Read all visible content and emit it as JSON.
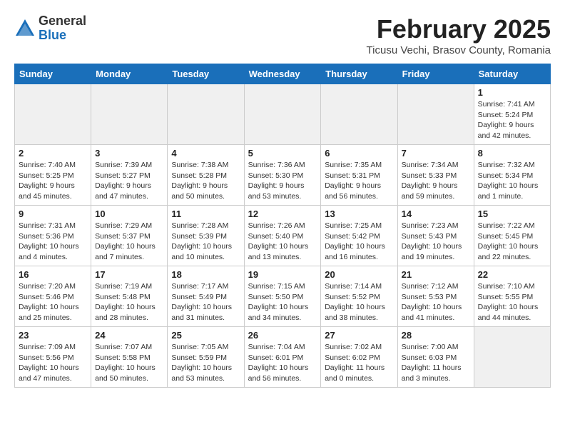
{
  "logo": {
    "general": "General",
    "blue": "Blue"
  },
  "header": {
    "month": "February 2025",
    "location": "Ticusu Vechi, Brasov County, Romania"
  },
  "weekdays": [
    "Sunday",
    "Monday",
    "Tuesday",
    "Wednesday",
    "Thursday",
    "Friday",
    "Saturday"
  ],
  "weeks": [
    [
      {
        "day": "",
        "info": ""
      },
      {
        "day": "",
        "info": ""
      },
      {
        "day": "",
        "info": ""
      },
      {
        "day": "",
        "info": ""
      },
      {
        "day": "",
        "info": ""
      },
      {
        "day": "",
        "info": ""
      },
      {
        "day": "1",
        "info": "Sunrise: 7:41 AM\nSunset: 5:24 PM\nDaylight: 9 hours and 42 minutes."
      }
    ],
    [
      {
        "day": "2",
        "info": "Sunrise: 7:40 AM\nSunset: 5:25 PM\nDaylight: 9 hours and 45 minutes."
      },
      {
        "day": "3",
        "info": "Sunrise: 7:39 AM\nSunset: 5:27 PM\nDaylight: 9 hours and 47 minutes."
      },
      {
        "day": "4",
        "info": "Sunrise: 7:38 AM\nSunset: 5:28 PM\nDaylight: 9 hours and 50 minutes."
      },
      {
        "day": "5",
        "info": "Sunrise: 7:36 AM\nSunset: 5:30 PM\nDaylight: 9 hours and 53 minutes."
      },
      {
        "day": "6",
        "info": "Sunrise: 7:35 AM\nSunset: 5:31 PM\nDaylight: 9 hours and 56 minutes."
      },
      {
        "day": "7",
        "info": "Sunrise: 7:34 AM\nSunset: 5:33 PM\nDaylight: 9 hours and 59 minutes."
      },
      {
        "day": "8",
        "info": "Sunrise: 7:32 AM\nSunset: 5:34 PM\nDaylight: 10 hours and 1 minute."
      }
    ],
    [
      {
        "day": "9",
        "info": "Sunrise: 7:31 AM\nSunset: 5:36 PM\nDaylight: 10 hours and 4 minutes."
      },
      {
        "day": "10",
        "info": "Sunrise: 7:29 AM\nSunset: 5:37 PM\nDaylight: 10 hours and 7 minutes."
      },
      {
        "day": "11",
        "info": "Sunrise: 7:28 AM\nSunset: 5:39 PM\nDaylight: 10 hours and 10 minutes."
      },
      {
        "day": "12",
        "info": "Sunrise: 7:26 AM\nSunset: 5:40 PM\nDaylight: 10 hours and 13 minutes."
      },
      {
        "day": "13",
        "info": "Sunrise: 7:25 AM\nSunset: 5:42 PM\nDaylight: 10 hours and 16 minutes."
      },
      {
        "day": "14",
        "info": "Sunrise: 7:23 AM\nSunset: 5:43 PM\nDaylight: 10 hours and 19 minutes."
      },
      {
        "day": "15",
        "info": "Sunrise: 7:22 AM\nSunset: 5:45 PM\nDaylight: 10 hours and 22 minutes."
      }
    ],
    [
      {
        "day": "16",
        "info": "Sunrise: 7:20 AM\nSunset: 5:46 PM\nDaylight: 10 hours and 25 minutes."
      },
      {
        "day": "17",
        "info": "Sunrise: 7:19 AM\nSunset: 5:48 PM\nDaylight: 10 hours and 28 minutes."
      },
      {
        "day": "18",
        "info": "Sunrise: 7:17 AM\nSunset: 5:49 PM\nDaylight: 10 hours and 31 minutes."
      },
      {
        "day": "19",
        "info": "Sunrise: 7:15 AM\nSunset: 5:50 PM\nDaylight: 10 hours and 34 minutes."
      },
      {
        "day": "20",
        "info": "Sunrise: 7:14 AM\nSunset: 5:52 PM\nDaylight: 10 hours and 38 minutes."
      },
      {
        "day": "21",
        "info": "Sunrise: 7:12 AM\nSunset: 5:53 PM\nDaylight: 10 hours and 41 minutes."
      },
      {
        "day": "22",
        "info": "Sunrise: 7:10 AM\nSunset: 5:55 PM\nDaylight: 10 hours and 44 minutes."
      }
    ],
    [
      {
        "day": "23",
        "info": "Sunrise: 7:09 AM\nSunset: 5:56 PM\nDaylight: 10 hours and 47 minutes."
      },
      {
        "day": "24",
        "info": "Sunrise: 7:07 AM\nSunset: 5:58 PM\nDaylight: 10 hours and 50 minutes."
      },
      {
        "day": "25",
        "info": "Sunrise: 7:05 AM\nSunset: 5:59 PM\nDaylight: 10 hours and 53 minutes."
      },
      {
        "day": "26",
        "info": "Sunrise: 7:04 AM\nSunset: 6:01 PM\nDaylight: 10 hours and 56 minutes."
      },
      {
        "day": "27",
        "info": "Sunrise: 7:02 AM\nSunset: 6:02 PM\nDaylight: 11 hours and 0 minutes."
      },
      {
        "day": "28",
        "info": "Sunrise: 7:00 AM\nSunset: 6:03 PM\nDaylight: 11 hours and 3 minutes."
      },
      {
        "day": "",
        "info": ""
      }
    ]
  ]
}
